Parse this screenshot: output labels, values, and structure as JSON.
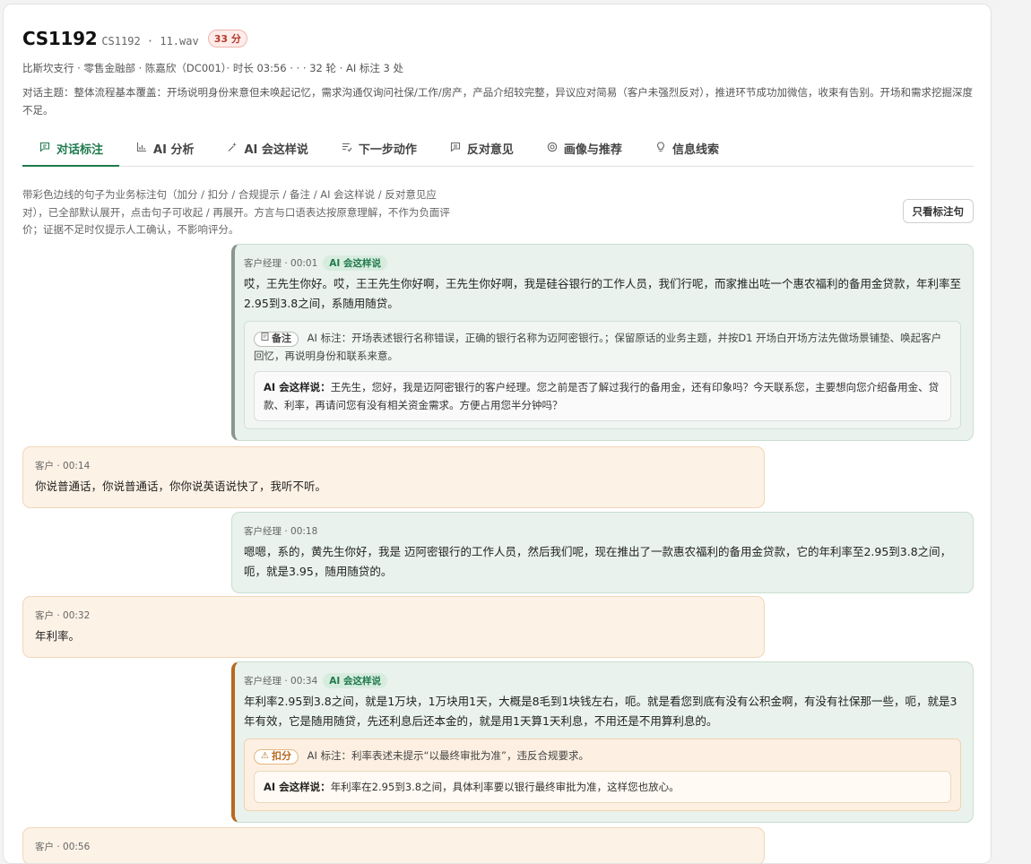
{
  "header": {
    "title": "CS1192",
    "file": "CS1192 · 11.wav",
    "score": "33 分",
    "meta": "比斯坎支行 · 零售金融部 · 陈嘉欣（DC001）· 时长 03:56 · · · 32 轮 · AI 标注 3 处",
    "summary": "对话主题：整体流程基本覆盖：开场说明身份来意但未唤起记忆，需求沟通仅询问社保/工作/房产，产品介绍较完整，异议应对简易（客户未强烈反对），推进环节成功加微信，收束有告别。开场和需求挖掘深度不足。"
  },
  "tabs": [
    {
      "label": "对话标注",
      "icon": "chat-icon"
    },
    {
      "label": "AI 分析",
      "icon": "bar-chart-icon"
    },
    {
      "label": "AI 会这样说",
      "icon": "sparkle-icon"
    },
    {
      "label": "下一步动作",
      "icon": "checklist-icon"
    },
    {
      "label": "反对意见",
      "icon": "comment-icon"
    },
    {
      "label": "画像与推荐",
      "icon": "target-icon"
    },
    {
      "label": "信息线索",
      "icon": "lightbulb-icon"
    }
  ],
  "hint": "带彩色边线的句子为业务标注句（加分 / 扣分 / 合规提示 / 备注 / AI 会这样说 / 反对意见应对），已全部默认展开，点击句子可收起 / 再展开。方言与口语表达按原意理解，不作为负面评价；证据不足时仅提示人工确认，不影响评分。",
  "filter_button": "只看标注句",
  "ai_tag": "AI 会这样说",
  "ai_say_prefix": "AI 会这样说：",
  "messages": [
    {
      "role": "客户经理",
      "time": "客户经理 · 00:01",
      "text": "哎，王先生你好。哎，王王先生你好啊，王先生你好啊，我是硅谷银行的工作人员，我们行呢，而家推出咗一个惠农福利的备用金贷款，年利率至2.95到3.8之间，系随用随贷。",
      "note_tag": "备注",
      "note": "AI 标注：开场表述银行名称错误，正确的银行名称为迈阿密银行。；保留原话的业务主题，并按D1 开场白开场方法先做场景铺垫、唤起客户回忆，再说明身份和联系来意。",
      "say": "王先生，您好，我是迈阿密银行的客户经理。您之前是否了解过我行的备用金，还有印象吗？今天联系您，主要想向您介绍备用金、贷款、利率，再请问您有没有相关资金需求。方便占用您半分钟吗？"
    },
    {
      "role": "客户",
      "time": "客户 · 00:14",
      "text": "你说普通话，你说普通话，你你说英语说快了，我听不听。"
    },
    {
      "role": "客户经理",
      "time": "客户经理 · 00:18",
      "text": "嗯嗯，系的，黄先生你好，我是 迈阿密银行的工作人员，然后我们呢，现在推出了一款惠农福利的备用金贷款，它的年利率至2.95到3.8之间，呃，就是3.95，随用随贷的。"
    },
    {
      "role": "客户",
      "time": "客户 · 00:32",
      "text": "年利率。"
    },
    {
      "role": "客户经理",
      "time": "客户经理 · 00:34",
      "text": "年利率2.95到3.8之间，就是1万块，1万块用1天，大概是8毛到1块钱左右，呃。就是看您到底有没有公积金啊，有没有社保那一些，呃，就是3年有效，它是随用随贷，先还利息后还本金的，就是用1天算1天利息，不用还是不用算利息的。",
      "note_tag": "扣分",
      "note": "AI 标注：利率表述未提示“以最终审批为准”，违反合规要求。",
      "say": "年利率在2.95到3.8之间，具体利率要以银行最终审批为准，这样您也放心。"
    },
    {
      "role": "客户",
      "time": "客户 · 00:56",
      "text": ""
    }
  ]
}
